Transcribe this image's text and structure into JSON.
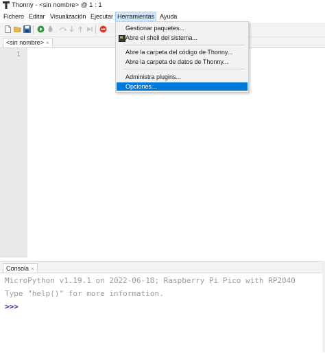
{
  "window": {
    "title": "Thonny  -  <sin nombre>  @  1 : 1"
  },
  "menubar": {
    "items": [
      "Fichero",
      "Editar",
      "Visualización",
      "Ejecutar",
      "Herramientas",
      "Ayuda"
    ],
    "active_item": "Herramientas"
  },
  "toolbar": {
    "buttons": [
      "new-file",
      "open-file",
      "save",
      "run",
      "debug",
      "step-over",
      "step-into",
      "step-out",
      "resume",
      "stop"
    ]
  },
  "editor": {
    "tab_label": "<sin nombre>",
    "tab_close": "×",
    "line_numbers": [
      "1"
    ]
  },
  "tools_menu": {
    "items": [
      {
        "label": "Gestionar paquetes...",
        "highlighted": false
      },
      {
        "label": "Abre el shell del sistema...",
        "highlighted": false,
        "icon": "terminal-icon"
      },
      {
        "label": "Abre la carpeta del código de Thonny...",
        "highlighted": false
      },
      {
        "label": "Abre la carpeta de datos de Thonny...",
        "highlighted": false
      },
      {
        "label": "Administra plugins...",
        "highlighted": false
      },
      {
        "label": "Opciones...",
        "highlighted": true
      }
    ]
  },
  "shell": {
    "tab_label": "Consola",
    "tab_close": "×",
    "lines": [
      "MicroPython v1.19.1 on 2022-06-18; Raspberry Pi Pico with RP2040",
      "Type \"help()\" for more information."
    ],
    "prompt": ">>>"
  },
  "colors": {
    "menu_highlight": "#0078d7",
    "active_menu_bg": "#cde8ff",
    "gutter": "#e9e9e9",
    "prompt": "#1a1aa6"
  }
}
